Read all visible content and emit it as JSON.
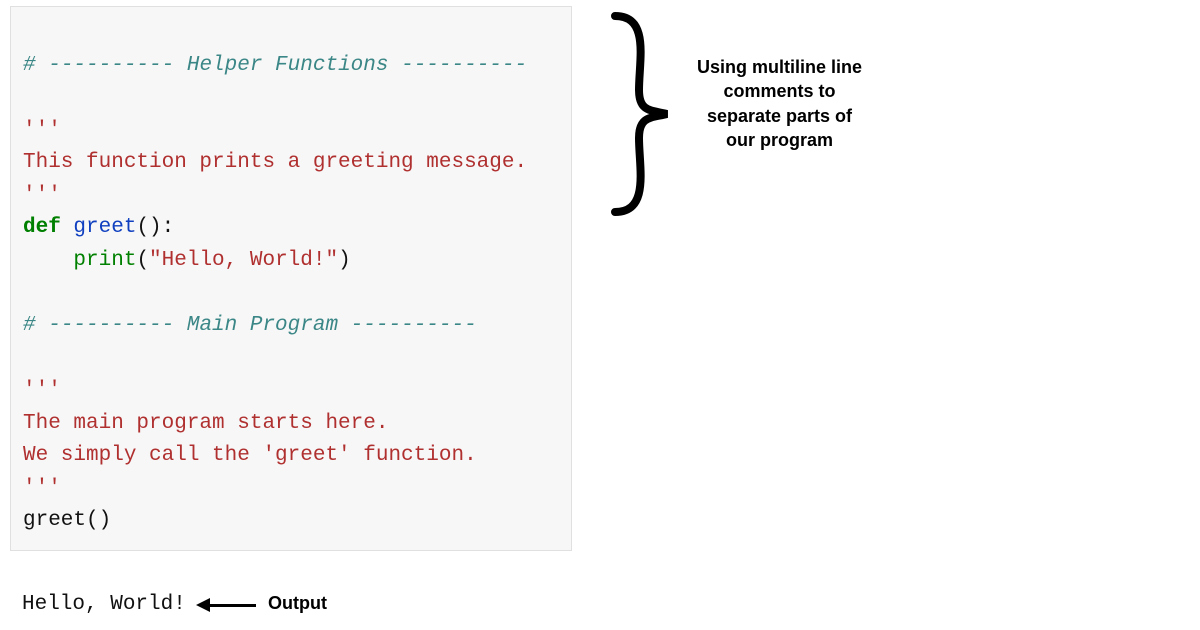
{
  "code": {
    "l1": {
      "hash": "#",
      "dashes1": " ---------- ",
      "title": "Helper Functions",
      "dashes2": " ----------"
    },
    "l3": "'''",
    "l4": "This function prints a greeting message.",
    "l5": "'''",
    "l6": {
      "kw": "def",
      "sp": " ",
      "fn": "greet",
      "rest": "():"
    },
    "l7": {
      "indent": "    ",
      "builtin": "print",
      "open": "(",
      "str": "\"Hello, World!\"",
      "close": ")"
    },
    "l9": {
      "hash": "#",
      "dashes1": " ---------- ",
      "title": "Main Program",
      "dashes2": " ----------"
    },
    "l11": "'''",
    "l12": "The main program starts here.",
    "l13": "We simply call the 'greet' function.",
    "l14": "'''",
    "l15": "greet()"
  },
  "output": {
    "text": "Hello, World!",
    "label": "Output"
  },
  "annotation": {
    "text": "Using multiline line comments to separate parts of our program"
  }
}
